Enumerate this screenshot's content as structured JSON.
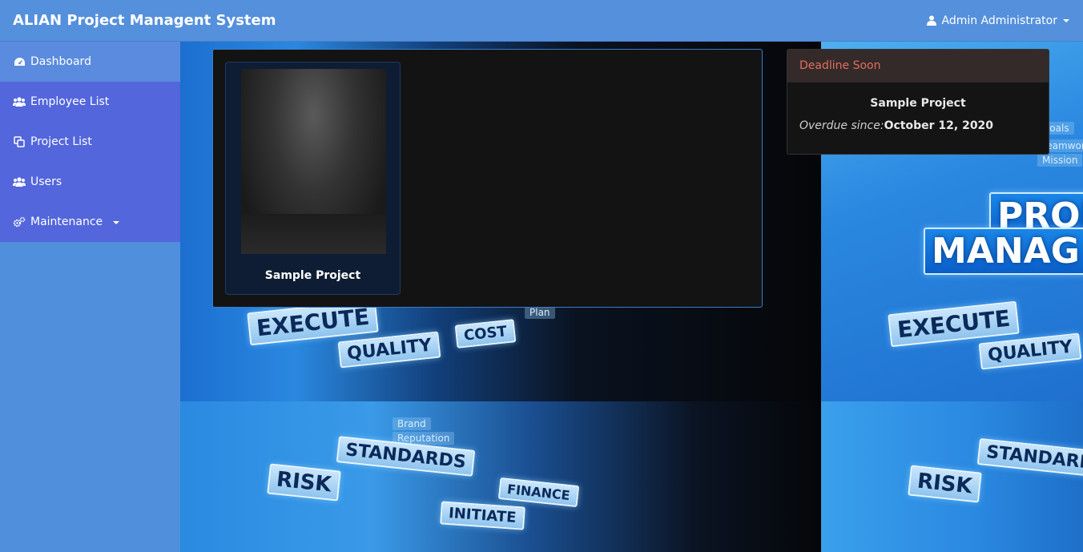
{
  "app": {
    "title": "ALIAN Project Managent System",
    "user_label": "Admin Administrator"
  },
  "sidebar": {
    "items": [
      {
        "label": "Dashboard",
        "icon": "dashboard-icon"
      },
      {
        "label": "Employee List",
        "icon": "users-icon"
      },
      {
        "label": "Project List",
        "icon": "copy-icon"
      },
      {
        "label": "Users",
        "icon": "users-icon"
      },
      {
        "label": "Maintenance",
        "icon": "cogs-icon"
      }
    ]
  },
  "projects": {
    "items": [
      {
        "title": "Sample Project"
      }
    ]
  },
  "deadline": {
    "header": "Deadline Soon",
    "project": "Sample Project",
    "overdue_label": "Overdue since:",
    "overdue_date": "October 12, 2020"
  },
  "background": {
    "signs": [
      "EXECUTE",
      "QUALITY",
      "COST",
      "RISK",
      "STANDARDS",
      "FINANCE",
      "INITIATE",
      "PROJ",
      "MANAG",
      "EXECUTE",
      "QUALITY",
      "RISK",
      "STANDARD"
    ],
    "small_labels": [
      "Brand",
      "Reputation",
      "Goals",
      "Teamwork",
      "Mission",
      "Plan"
    ]
  },
  "colors": {
    "navbar": "#5590dc",
    "sidebar_item": "#5366dc",
    "sidebar_active": "#5a8bde",
    "deadline_header_text": "#e0705e"
  }
}
